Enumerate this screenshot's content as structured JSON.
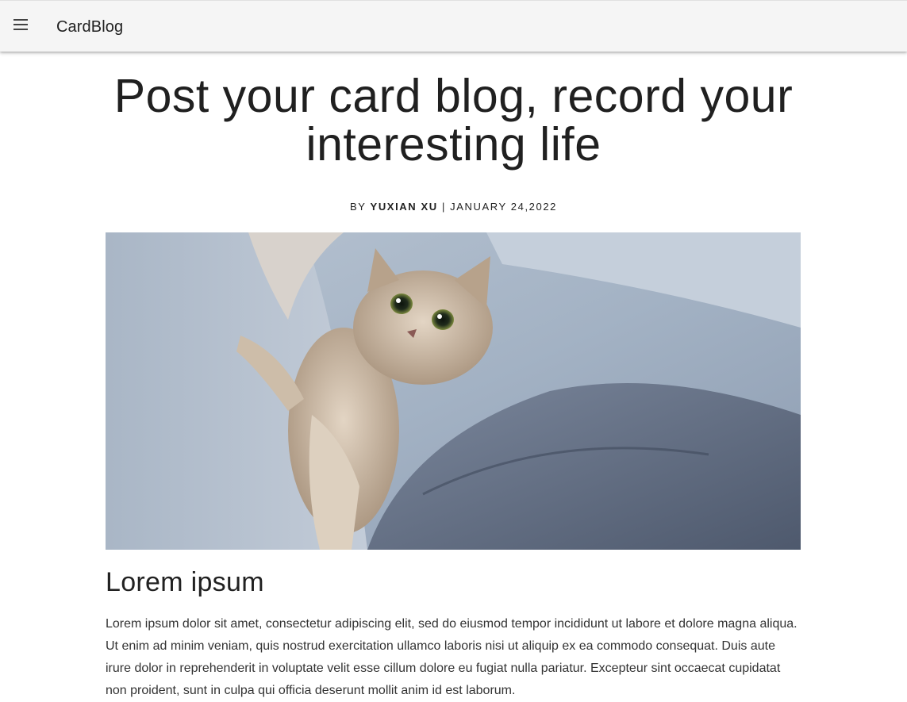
{
  "appbar": {
    "menu_icon": "menu-icon",
    "brand": "CardBlog"
  },
  "post": {
    "title": "Post your card blog, record your interesting life",
    "byline_prefix": "BY",
    "author": "YUXIAN XU",
    "separator": "|",
    "date": "JANUARY 24,2022",
    "section_heading": "Lorem ipsum",
    "body": "Lorem ipsum dolor sit amet, consectetur adipiscing elit, sed do eiusmod tempor incididunt ut labore et dolore magna aliqua. Ut enim ad minim veniam, quis nostrud exercitation ullamco laboris nisi ut aliquip ex ea commodo consequat. Duis aute irure dolor in reprehenderit in voluptate velit esse cillum dolore eu fugiat nulla pariatur. Excepteur sint occaecat cupidatat non proident, sunt in culpa qui officia deserunt mollit anim id est laborum."
  },
  "colors": {
    "appbar_bg": "#f5f5f5",
    "text_primary": "#212121",
    "page_bg": "#ffffff"
  }
}
